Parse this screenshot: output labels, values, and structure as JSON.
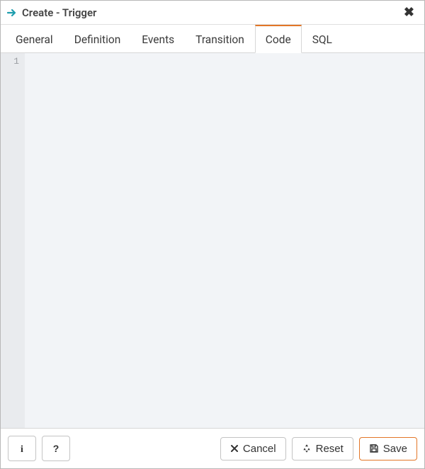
{
  "title": "Create - Trigger",
  "tabs": {
    "general": "General",
    "definition": "Definition",
    "events": "Events",
    "transition": "Transition",
    "code": "Code",
    "sql": "SQL"
  },
  "active_tab": "code",
  "editor": {
    "line_number": "1",
    "content": ""
  },
  "footer": {
    "info_tooltip": "i",
    "help_tooltip": "?",
    "cancel": "Cancel",
    "reset": "Reset",
    "save": "Save"
  }
}
